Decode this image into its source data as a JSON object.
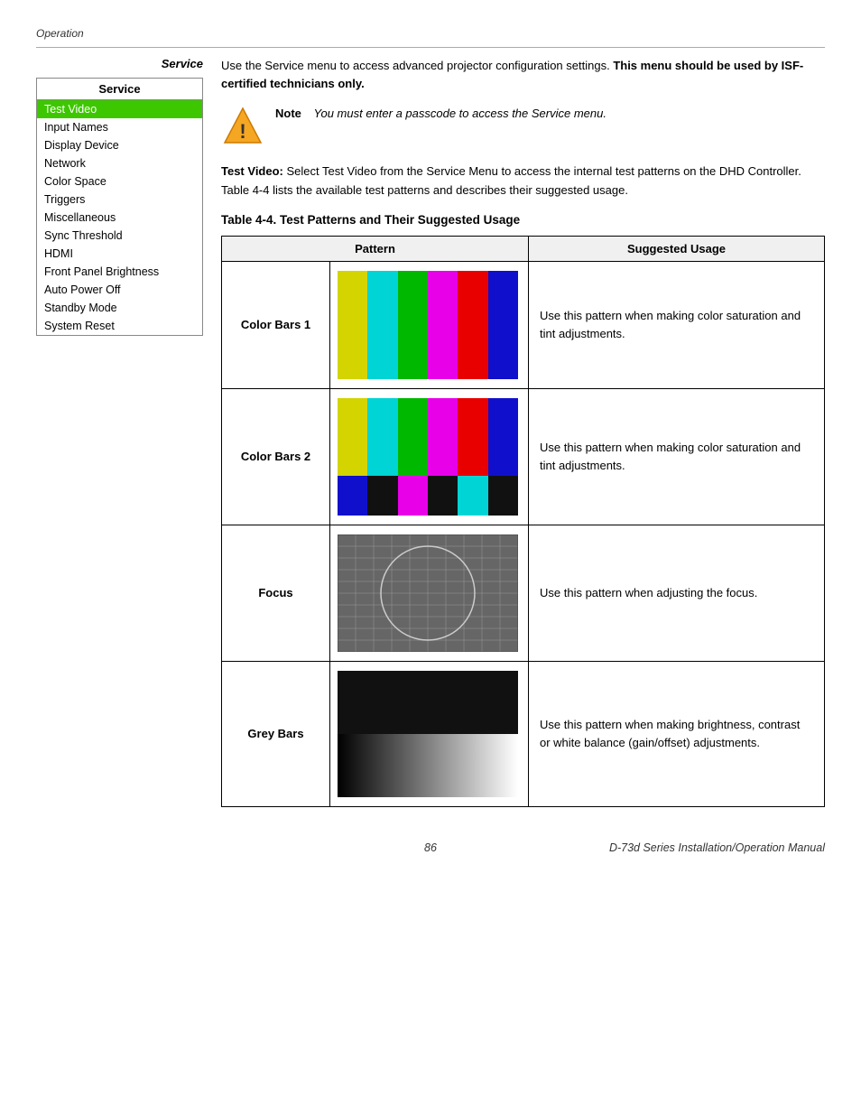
{
  "header": {
    "breadcrumb": "Operation"
  },
  "sidebar": {
    "title_label": "Service",
    "menu_header": "Service",
    "items": [
      {
        "label": "Test Video",
        "active": true
      },
      {
        "label": "Input Names",
        "active": false
      },
      {
        "label": "Display Device",
        "active": false
      },
      {
        "label": "Network",
        "active": false
      },
      {
        "label": "Color Space",
        "active": false
      },
      {
        "label": "Triggers",
        "active": false
      },
      {
        "label": "Miscellaneous",
        "active": false
      },
      {
        "label": "Sync Threshold",
        "active": false
      },
      {
        "label": "HDMI",
        "active": false
      },
      {
        "label": "Front Panel Brightness",
        "active": false
      },
      {
        "label": "Auto Power Off",
        "active": false
      },
      {
        "label": "Standby Mode",
        "active": false
      },
      {
        "label": "System Reset",
        "active": false
      }
    ]
  },
  "main": {
    "service_intro": "Use the Service menu to access advanced projector configuration settings.",
    "service_intro_bold": "This menu should be used by ISF-certified technicians only.",
    "note_label": "Note",
    "note_text": "You must enter a passcode to access the Service menu.",
    "test_video_intro_bold": "Test Video:",
    "test_video_intro": " Select Test Video from the Service Menu to access the internal test patterns on the DHD Controller. Table 4-4 lists the available test patterns and describes their suggested usage.",
    "table_title": "Table 4-4. Test Patterns and Their Suggested Usage",
    "table_col1": "Pattern",
    "table_col2": "Suggested Usage",
    "patterns": [
      {
        "name": "Color Bars 1",
        "type": "color_bars_1",
        "usage": "Use this pattern when making color saturation and tint adjustments."
      },
      {
        "name": "Color Bars 2",
        "type": "color_bars_2",
        "usage": "Use this pattern when making color saturation and tint adjustments."
      },
      {
        "name": "Focus",
        "type": "focus",
        "usage": "Use this pattern when adjusting the focus."
      },
      {
        "name": "Grey Bars",
        "type": "grey_bars",
        "usage": "Use this pattern when making brightness, contrast or white balance (gain/offset) adjustments."
      }
    ]
  },
  "footer": {
    "page_number": "86",
    "right_text": "D-73d Series Installation/Operation Manual"
  }
}
